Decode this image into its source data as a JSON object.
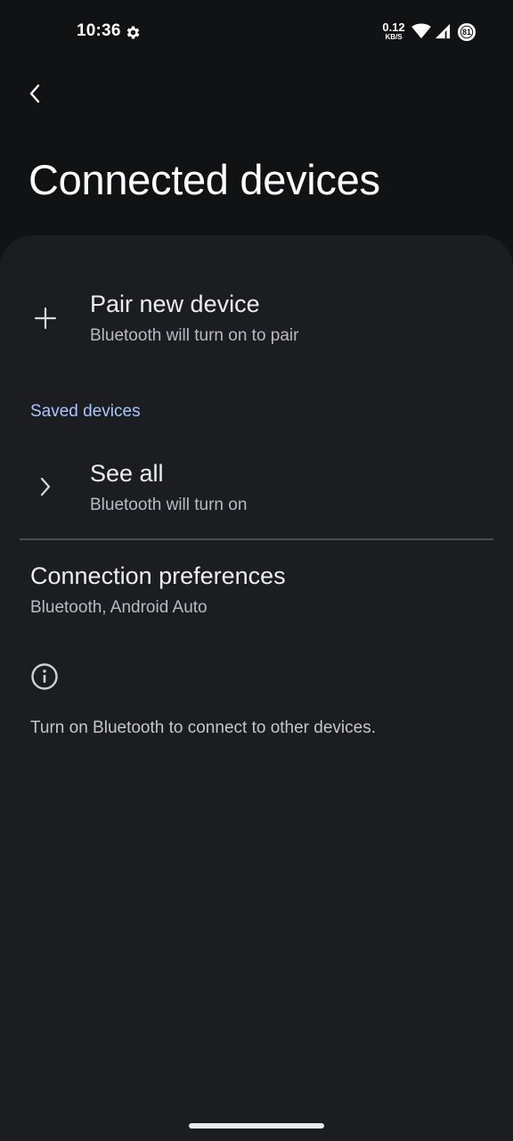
{
  "status_bar": {
    "time": "10:36",
    "net_speed_value": "0.12",
    "net_speed_unit": "KB/S",
    "battery_level": "81",
    "icons": [
      "settings-gear-icon",
      "wifi-icon",
      "cell-signal-icon",
      "battery-icon"
    ]
  },
  "header": {
    "title": "Connected devices",
    "back_icon": "chevron-left-icon"
  },
  "pair": {
    "title": "Pair new device",
    "subtitle": "Bluetooth will turn on to pair",
    "icon": "plus-icon"
  },
  "saved_devices": {
    "header": "Saved devices",
    "see_all_title": "See all",
    "see_all_subtitle": "Bluetooth will turn on",
    "icon": "chevron-right-icon"
  },
  "connection_preferences": {
    "title": "Connection preferences",
    "subtitle": "Bluetooth, Android Auto"
  },
  "footer": {
    "info_icon": "info-icon",
    "text": "Turn on Bluetooth to connect to other devices."
  },
  "colors": {
    "background": "#111214",
    "surface": "#1c1d21",
    "accent": "#a9c7ff"
  }
}
